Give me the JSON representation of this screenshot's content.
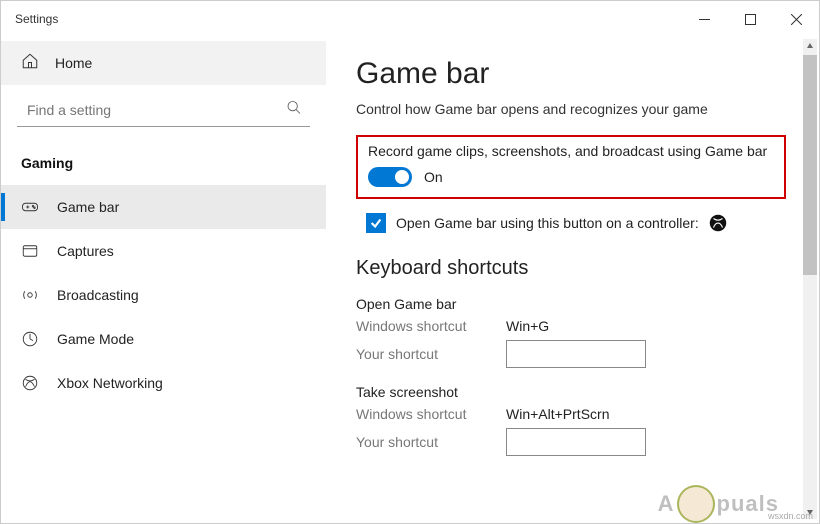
{
  "window": {
    "title": "Settings"
  },
  "sidebar": {
    "home": "Home",
    "search_placeholder": "Find a setting",
    "category": "Gaming",
    "items": [
      {
        "label": "Game bar",
        "selected": true
      },
      {
        "label": "Captures",
        "selected": false
      },
      {
        "label": "Broadcasting",
        "selected": false
      },
      {
        "label": "Game Mode",
        "selected": false
      },
      {
        "label": "Xbox Networking",
        "selected": false
      }
    ]
  },
  "page": {
    "title": "Game bar",
    "subtitle": "Control how Game bar opens and recognizes your game",
    "record_setting": {
      "label": "Record game clips, screenshots, and broadcast using Game bar",
      "state": "On",
      "on": true
    },
    "controller_checkbox": {
      "label": "Open Game bar using this button on a controller:",
      "checked": true
    },
    "shortcuts_header": "Keyboard shortcuts",
    "shortcuts": [
      {
        "title": "Open Game bar",
        "windows_label": "Windows shortcut",
        "windows_value": "Win+G",
        "your_label": "Your shortcut",
        "your_value": ""
      },
      {
        "title": "Take screenshot",
        "windows_label": "Windows shortcut",
        "windows_value": "Win+Alt+PrtScrn",
        "your_label": "Your shortcut",
        "your_value": ""
      }
    ]
  },
  "watermark": {
    "text_left": "A",
    "text_right": "puals"
  },
  "footer": "wsxdn.com"
}
